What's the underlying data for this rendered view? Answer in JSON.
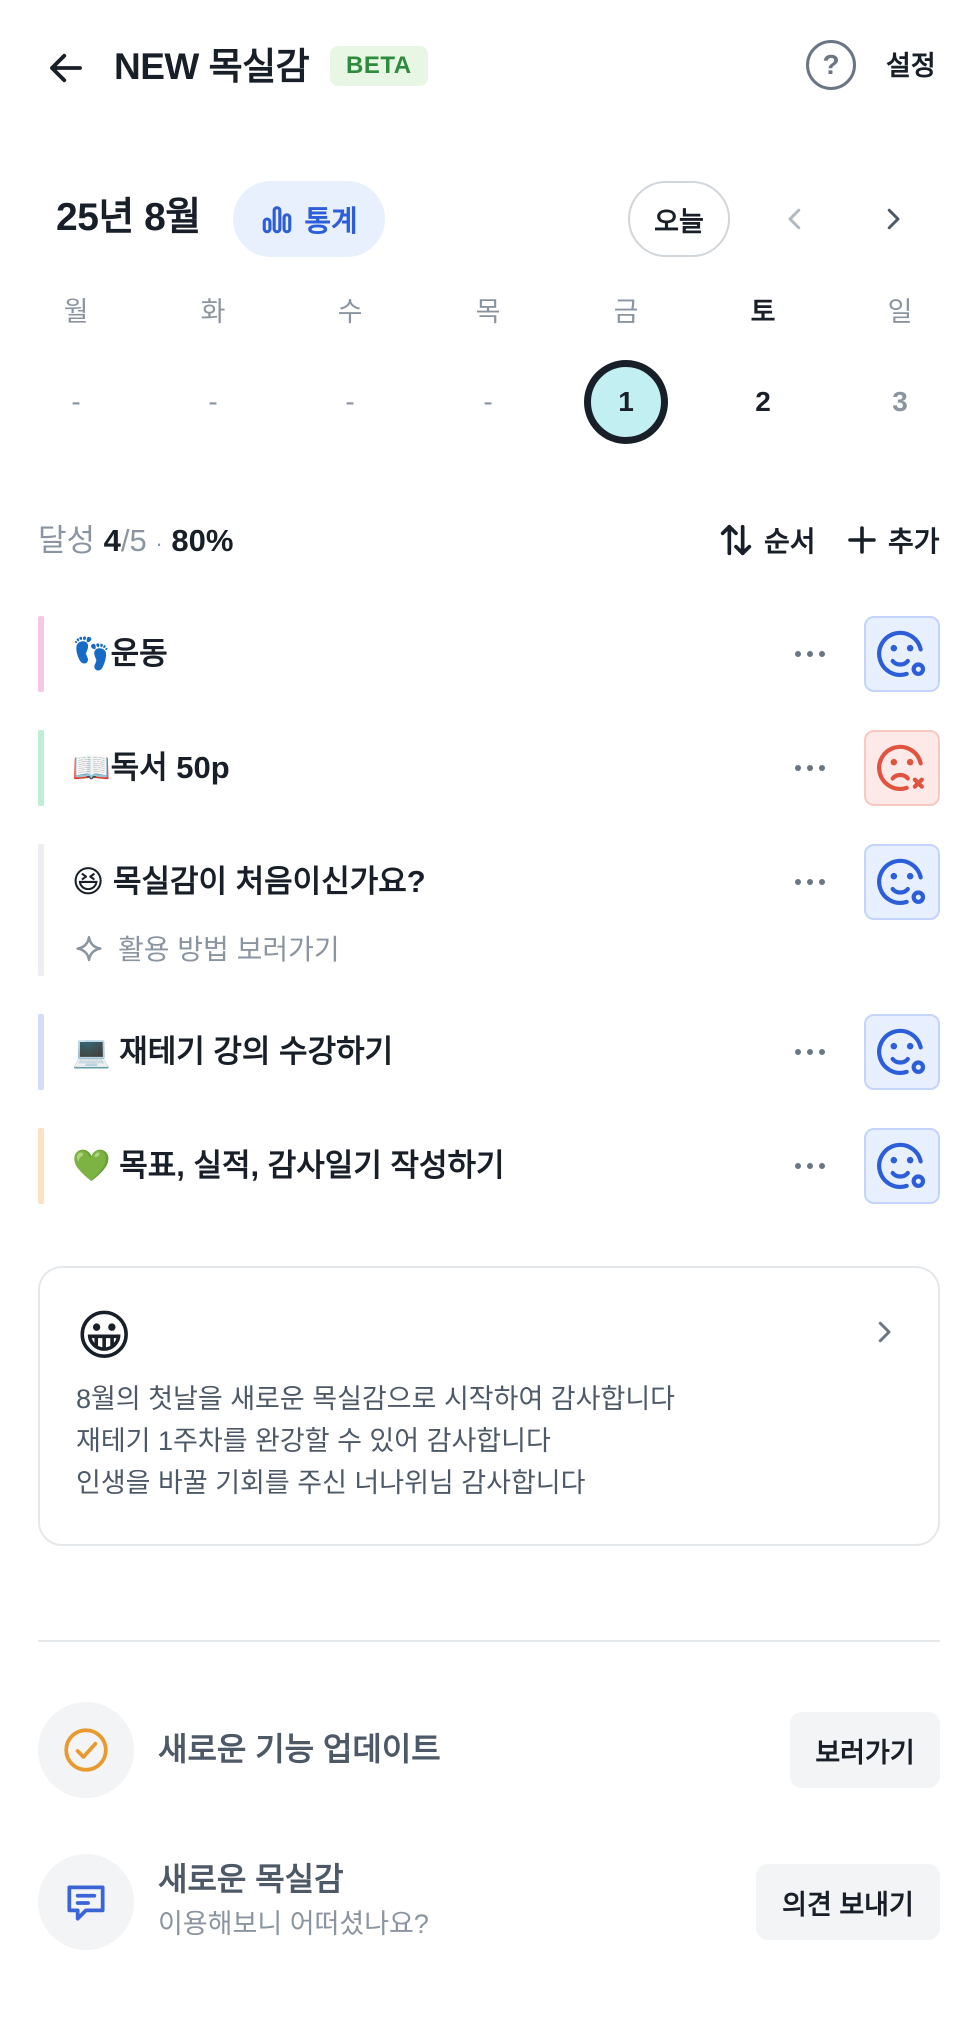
{
  "header": {
    "title": "NEW 목실감",
    "badge": "BETA",
    "help_icon": "question-circle-icon",
    "settings_label": "설정"
  },
  "calendar": {
    "month_label": "25년 8월",
    "stats_label": "통계",
    "today_label": "오늘",
    "weekdays": [
      "월",
      "화",
      "수",
      "목",
      "금",
      "토",
      "일"
    ],
    "days": [
      "-",
      "-",
      "-",
      "-",
      "1",
      "2",
      "3"
    ],
    "selected_index": 4
  },
  "summary": {
    "label": "달성",
    "done": "4",
    "total": "/5",
    "separator": "·",
    "percent": "80%",
    "order_label": "순서",
    "add_label": "추가"
  },
  "habits": [
    {
      "emoji": "👣",
      "name": "운동",
      "color": "#f9c6e4",
      "status": "done"
    },
    {
      "emoji": "📖",
      "name": "독서 50p",
      "color": "#bfeed5",
      "status": "fail"
    },
    {
      "emoji": "😆",
      "name": " 목실감이 처음이신가요?",
      "color": "#eceef1",
      "status": "done",
      "sub": "활용 방법 보러가기"
    },
    {
      "emoji": "💻",
      "name": " 재테기 강의 수강하기",
      "color": "#d4dcfb",
      "status": "done"
    },
    {
      "emoji": "💚",
      "name": " 목표, 실적, 감사일기 작성하기",
      "color": "#fde1c2",
      "status": "done"
    }
  ],
  "diary": {
    "emoji": "😀",
    "lines": [
      "8월의 첫날을 새로운 목실감으로 시작하여 감사합니다",
      "재테기 1주차를 완강할 수 있어 감사합니다",
      "인생을 바꿀 기회를 주신 너나위님 감사합니다"
    ]
  },
  "updates": {
    "title": "새로운 기능 업데이트",
    "button": "보러가기"
  },
  "feedback": {
    "title": "새로운 목실감",
    "subtitle": "이용해보니 어떠셨나요?",
    "button": "의견 보내기"
  },
  "colors": {
    "accent": "#2b5ed8",
    "success_badge": "#2e8b3d",
    "fail": "#e0533f",
    "update_icon": "#e89a2e",
    "feedback_icon": "#3b64d6"
  }
}
